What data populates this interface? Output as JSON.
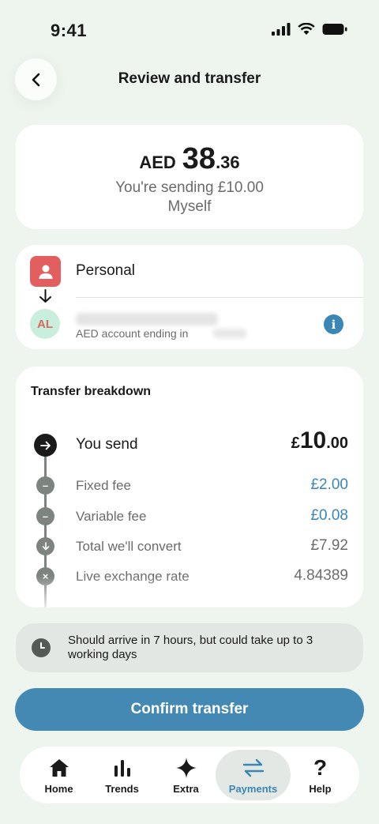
{
  "status_bar": {
    "time": "9:41"
  },
  "header": {
    "title": "Review and transfer"
  },
  "amount": {
    "currency": "AED",
    "major": "38",
    "minor": ".36",
    "sending_text": "You're sending £10.00",
    "recipient": "Myself"
  },
  "accounts": {
    "from_label": "Personal",
    "to_initials": "AL",
    "to_account_text": "AED account ending in"
  },
  "breakdown": {
    "title": "Transfer breakdown",
    "send": {
      "label": "You send",
      "symbol": "£",
      "major": "10",
      "minor": ".00"
    },
    "rows": [
      {
        "label": "Fixed fee",
        "value": "£2.00"
      },
      {
        "label": "Variable fee",
        "value": "£0.08"
      },
      {
        "label": "Total we'll convert",
        "value": "£7.92"
      },
      {
        "label": "Live exchange rate",
        "value": "4.84389"
      }
    ]
  },
  "arrival": {
    "text": "Should arrive in 7 hours, but could take up to 3 working days"
  },
  "confirm": {
    "label": "Confirm transfer"
  },
  "nav": {
    "items": [
      {
        "label": "Home",
        "icon": "home-icon"
      },
      {
        "label": "Trends",
        "icon": "trends-icon"
      },
      {
        "label": "Extra",
        "icon": "sparkle-icon"
      },
      {
        "label": "Payments",
        "icon": "transfer-arrows-icon"
      },
      {
        "label": "Help",
        "icon": "question-icon"
      }
    ]
  },
  "colors": {
    "accent": "#4389b3",
    "link": "#3a86b4",
    "background": "#eef5ee",
    "personal": "#e35e5e"
  }
}
